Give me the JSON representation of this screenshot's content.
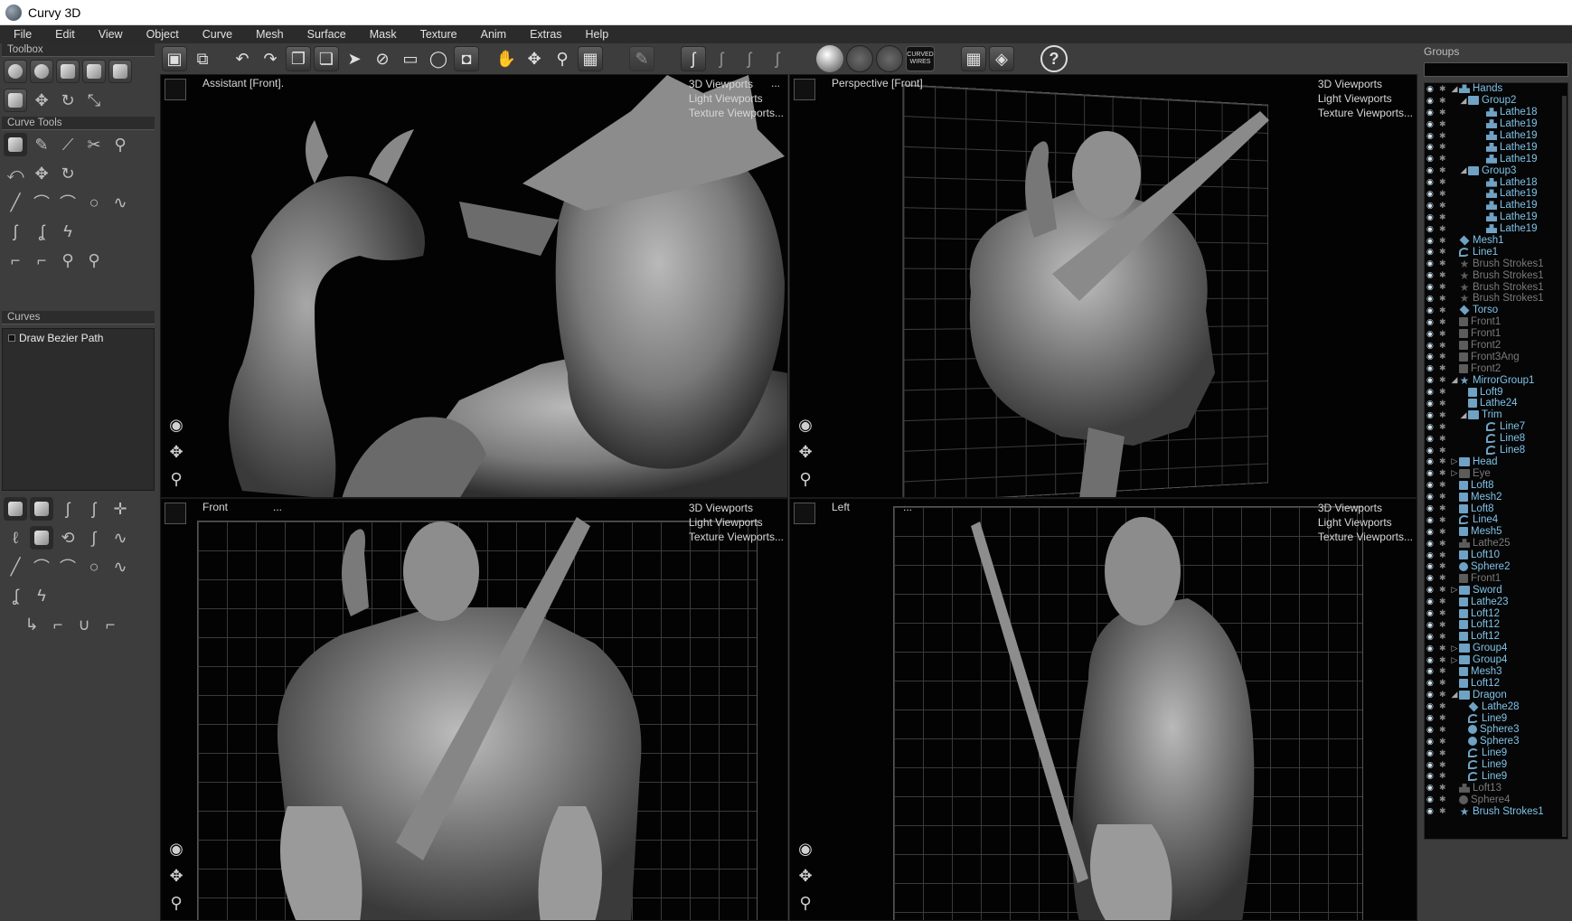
{
  "window": {
    "title": "Curvy 3D"
  },
  "menu": [
    "File",
    "Edit",
    "View",
    "Object",
    "Curve",
    "Mesh",
    "Surface",
    "Mask",
    "Texture",
    "Anim",
    "Extras",
    "Help"
  ],
  "toolbox": {
    "title": "Toolbox",
    "curve_tools_title": "Curve Tools",
    "curves_title": "Curves",
    "curves_items": [
      "Draw Bezier Path"
    ]
  },
  "viewport_menu": [
    "3D Viewports",
    "Light Viewports",
    "Texture Viewports..."
  ],
  "viewports": [
    {
      "id": "assistant",
      "name": "Assistant [Front].",
      "dots": "..."
    },
    {
      "id": "perspective",
      "name": "Perspective [Front]",
      "dots": ""
    },
    {
      "id": "front",
      "name": "Front",
      "dots": "..."
    },
    {
      "id": "left",
      "name": "Left",
      "dots": "..."
    }
  ],
  "toolbar": {
    "curved_wires_label": "CURVED WIRES",
    "help_glyph": "?"
  },
  "groups": {
    "title": "Groups",
    "items": [
      {
        "label": "Hands",
        "indent": 0,
        "icon": "person",
        "expanded": true,
        "dim": false
      },
      {
        "label": "Group2",
        "indent": 1,
        "icon": "folder",
        "expanded": true,
        "dim": false
      },
      {
        "label": "Lathe18",
        "indent": 3,
        "icon": "person",
        "dim": false
      },
      {
        "label": "Lathe19",
        "indent": 3,
        "icon": "person",
        "dim": false
      },
      {
        "label": "Lathe19",
        "indent": 3,
        "icon": "person",
        "dim": false
      },
      {
        "label": "Lathe19",
        "indent": 3,
        "icon": "person",
        "dim": false
      },
      {
        "label": "Lathe19",
        "indent": 3,
        "icon": "person",
        "dim": false
      },
      {
        "label": "Group3",
        "indent": 1,
        "icon": "folder",
        "expanded": true,
        "dim": false
      },
      {
        "label": "Lathe18",
        "indent": 3,
        "icon": "person",
        "dim": false
      },
      {
        "label": "Lathe19",
        "indent": 3,
        "icon": "person",
        "dim": false
      },
      {
        "label": "Lathe19",
        "indent": 3,
        "icon": "person",
        "dim": false
      },
      {
        "label": "Lathe19",
        "indent": 3,
        "icon": "person",
        "dim": false
      },
      {
        "label": "Lathe19",
        "indent": 3,
        "icon": "person",
        "dim": false
      },
      {
        "label": "Mesh1",
        "indent": 0,
        "icon": "diamond",
        "dim": false
      },
      {
        "label": "Line1",
        "indent": 0,
        "icon": "curve",
        "dim": false
      },
      {
        "label": "Brush Strokes1",
        "indent": 0,
        "icon": "star",
        "dim": true
      },
      {
        "label": "Brush Strokes1",
        "indent": 0,
        "icon": "star",
        "dim": true
      },
      {
        "label": "Brush Strokes1",
        "indent": 0,
        "icon": "star",
        "dim": true
      },
      {
        "label": "Brush Strokes1",
        "indent": 0,
        "icon": "star",
        "dim": true
      },
      {
        "label": "Torso",
        "indent": 0,
        "icon": "diamond",
        "dim": false
      },
      {
        "label": "Front1",
        "indent": 0,
        "icon": "loft",
        "dim": true
      },
      {
        "label": "Front1",
        "indent": 0,
        "icon": "loft",
        "dim": true
      },
      {
        "label": "Front2",
        "indent": 0,
        "icon": "loft",
        "dim": true
      },
      {
        "label": "Front3Ang",
        "indent": 0,
        "icon": "loft",
        "dim": true
      },
      {
        "label": "Front2",
        "indent": 0,
        "icon": "loft",
        "dim": true
      },
      {
        "label": "MirrorGroup1",
        "indent": 0,
        "icon": "star",
        "expanded": true,
        "dim": false
      },
      {
        "label": "Loft9",
        "indent": 1,
        "icon": "loft",
        "dim": false
      },
      {
        "label": "Lathe24",
        "indent": 1,
        "icon": "loft",
        "dim": false
      },
      {
        "label": "Trim",
        "indent": 1,
        "icon": "folder",
        "expanded": true,
        "dim": false
      },
      {
        "label": "Line7",
        "indent": 3,
        "icon": "curve",
        "dim": false
      },
      {
        "label": "Line8",
        "indent": 3,
        "icon": "curve",
        "dim": false
      },
      {
        "label": "Line8",
        "indent": 3,
        "icon": "curve",
        "dim": false
      },
      {
        "label": "Head",
        "indent": 0,
        "icon": "folder",
        "collapsed": true,
        "dim": false
      },
      {
        "label": "Eye",
        "indent": 0,
        "icon": "folder",
        "collapsed": true,
        "dim": true
      },
      {
        "label": "Loft8",
        "indent": 0,
        "icon": "loft",
        "dim": false
      },
      {
        "label": "Mesh2",
        "indent": 0,
        "icon": "loft",
        "dim": false
      },
      {
        "label": "Loft8",
        "indent": 0,
        "icon": "loft",
        "dim": false
      },
      {
        "label": "Line4",
        "indent": 0,
        "icon": "curve",
        "dim": false
      },
      {
        "label": "Mesh5",
        "indent": 0,
        "icon": "loft",
        "dim": false
      },
      {
        "label": "Lathe25",
        "indent": 0,
        "icon": "person",
        "dim": true
      },
      {
        "label": "Loft10",
        "indent": 0,
        "icon": "loft",
        "dim": false
      },
      {
        "label": "Sphere2",
        "indent": 0,
        "icon": "sphere",
        "dim": false
      },
      {
        "label": "Front1",
        "indent": 0,
        "icon": "loft",
        "dim": true
      },
      {
        "label": "Sword",
        "indent": 0,
        "icon": "folder",
        "collapsed": true,
        "dim": false
      },
      {
        "label": "Lathe23",
        "indent": 0,
        "icon": "loft",
        "dim": false
      },
      {
        "label": "Loft12",
        "indent": 0,
        "icon": "loft",
        "dim": false
      },
      {
        "label": "Loft12",
        "indent": 0,
        "icon": "loft",
        "dim": false
      },
      {
        "label": "Loft12",
        "indent": 0,
        "icon": "loft",
        "dim": false
      },
      {
        "label": "Group4",
        "indent": 0,
        "icon": "folder",
        "collapsed": true,
        "dim": false
      },
      {
        "label": "Group4",
        "indent": 0,
        "icon": "folder",
        "collapsed": true,
        "dim": false
      },
      {
        "label": "Mesh3",
        "indent": 0,
        "icon": "loft",
        "dim": false
      },
      {
        "label": "Loft12",
        "indent": 0,
        "icon": "loft",
        "dim": false
      },
      {
        "label": "Dragon",
        "indent": 0,
        "icon": "folder",
        "expanded": true,
        "dim": false
      },
      {
        "label": "Lathe28",
        "indent": 1,
        "icon": "diamond",
        "dim": false
      },
      {
        "label": "Line9",
        "indent": 1,
        "icon": "curve",
        "dim": false
      },
      {
        "label": "Sphere3",
        "indent": 1,
        "icon": "sphere",
        "dim": false
      },
      {
        "label": "Sphere3",
        "indent": 1,
        "icon": "sphere",
        "dim": false
      },
      {
        "label": "Line9",
        "indent": 1,
        "icon": "curve",
        "dim": false
      },
      {
        "label": "Line9",
        "indent": 1,
        "icon": "curve",
        "dim": false
      },
      {
        "label": "Line9",
        "indent": 1,
        "icon": "curve",
        "dim": false
      },
      {
        "label": "Loft13",
        "indent": 0,
        "icon": "person",
        "dim": true
      },
      {
        "label": "Sphere4",
        "indent": 0,
        "icon": "sphere",
        "dim": true
      },
      {
        "label": "Brush Strokes1",
        "indent": 0,
        "icon": "star",
        "dim": false
      }
    ]
  },
  "colors": {
    "accent": "#7fc3e8",
    "panel": "#3d3d3d",
    "viewport_bg": "#030303"
  }
}
